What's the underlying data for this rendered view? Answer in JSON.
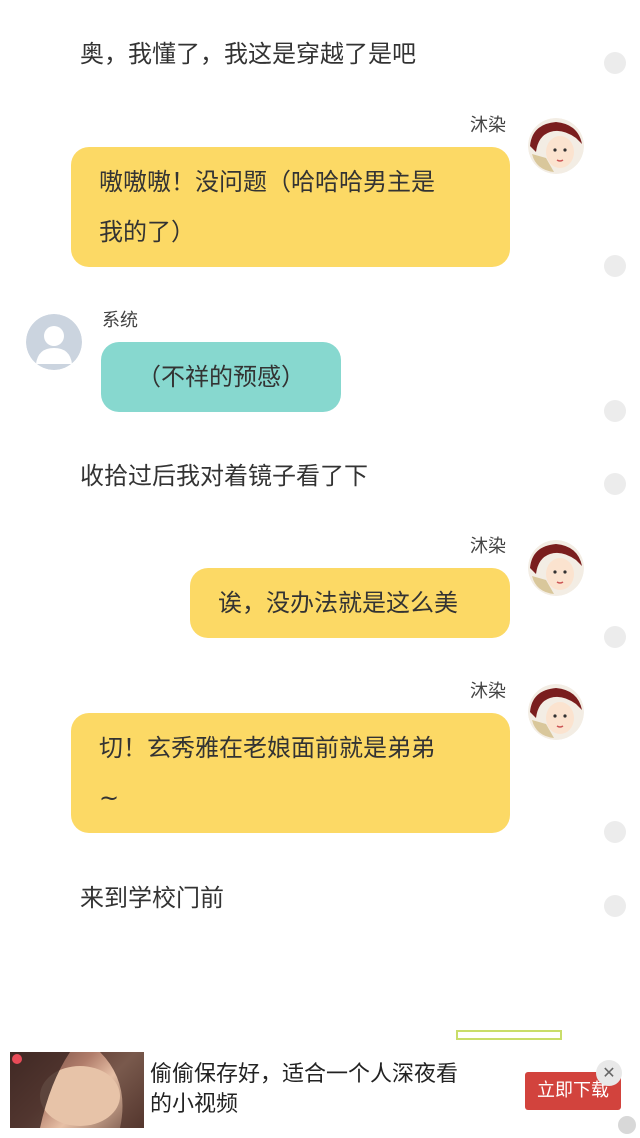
{
  "messages": [
    {
      "kind": "narration",
      "text": "奥，我懂了，我这是穿越了是吧"
    },
    {
      "kind": "right",
      "name": "沐染",
      "lines": [
        "嗷嗷嗷！没问题（哈哈哈男主是",
        "我的了）"
      ]
    },
    {
      "kind": "left",
      "name": "系统",
      "lines": [
        "（不祥的预感）"
      ]
    },
    {
      "kind": "narration",
      "text": "收拾过后我对着镜子看了下"
    },
    {
      "kind": "right",
      "name": "沐染",
      "lines": [
        "诶，没办法就是这么美"
      ]
    },
    {
      "kind": "right",
      "name": "沐染",
      "lines": [
        "切！玄秀雅在老娘面前就是弟弟",
        "~"
      ]
    },
    {
      "kind": "narration",
      "text": "来到学校门前"
    }
  ],
  "ad": {
    "text_lines": [
      "偷偷保存好，适合一个人深夜看",
      "的小视频"
    ],
    "button": "立即下载",
    "close": "✕"
  },
  "colors": {
    "user_bubble": "#fcd965",
    "system_bubble": "#87d8cf"
  }
}
